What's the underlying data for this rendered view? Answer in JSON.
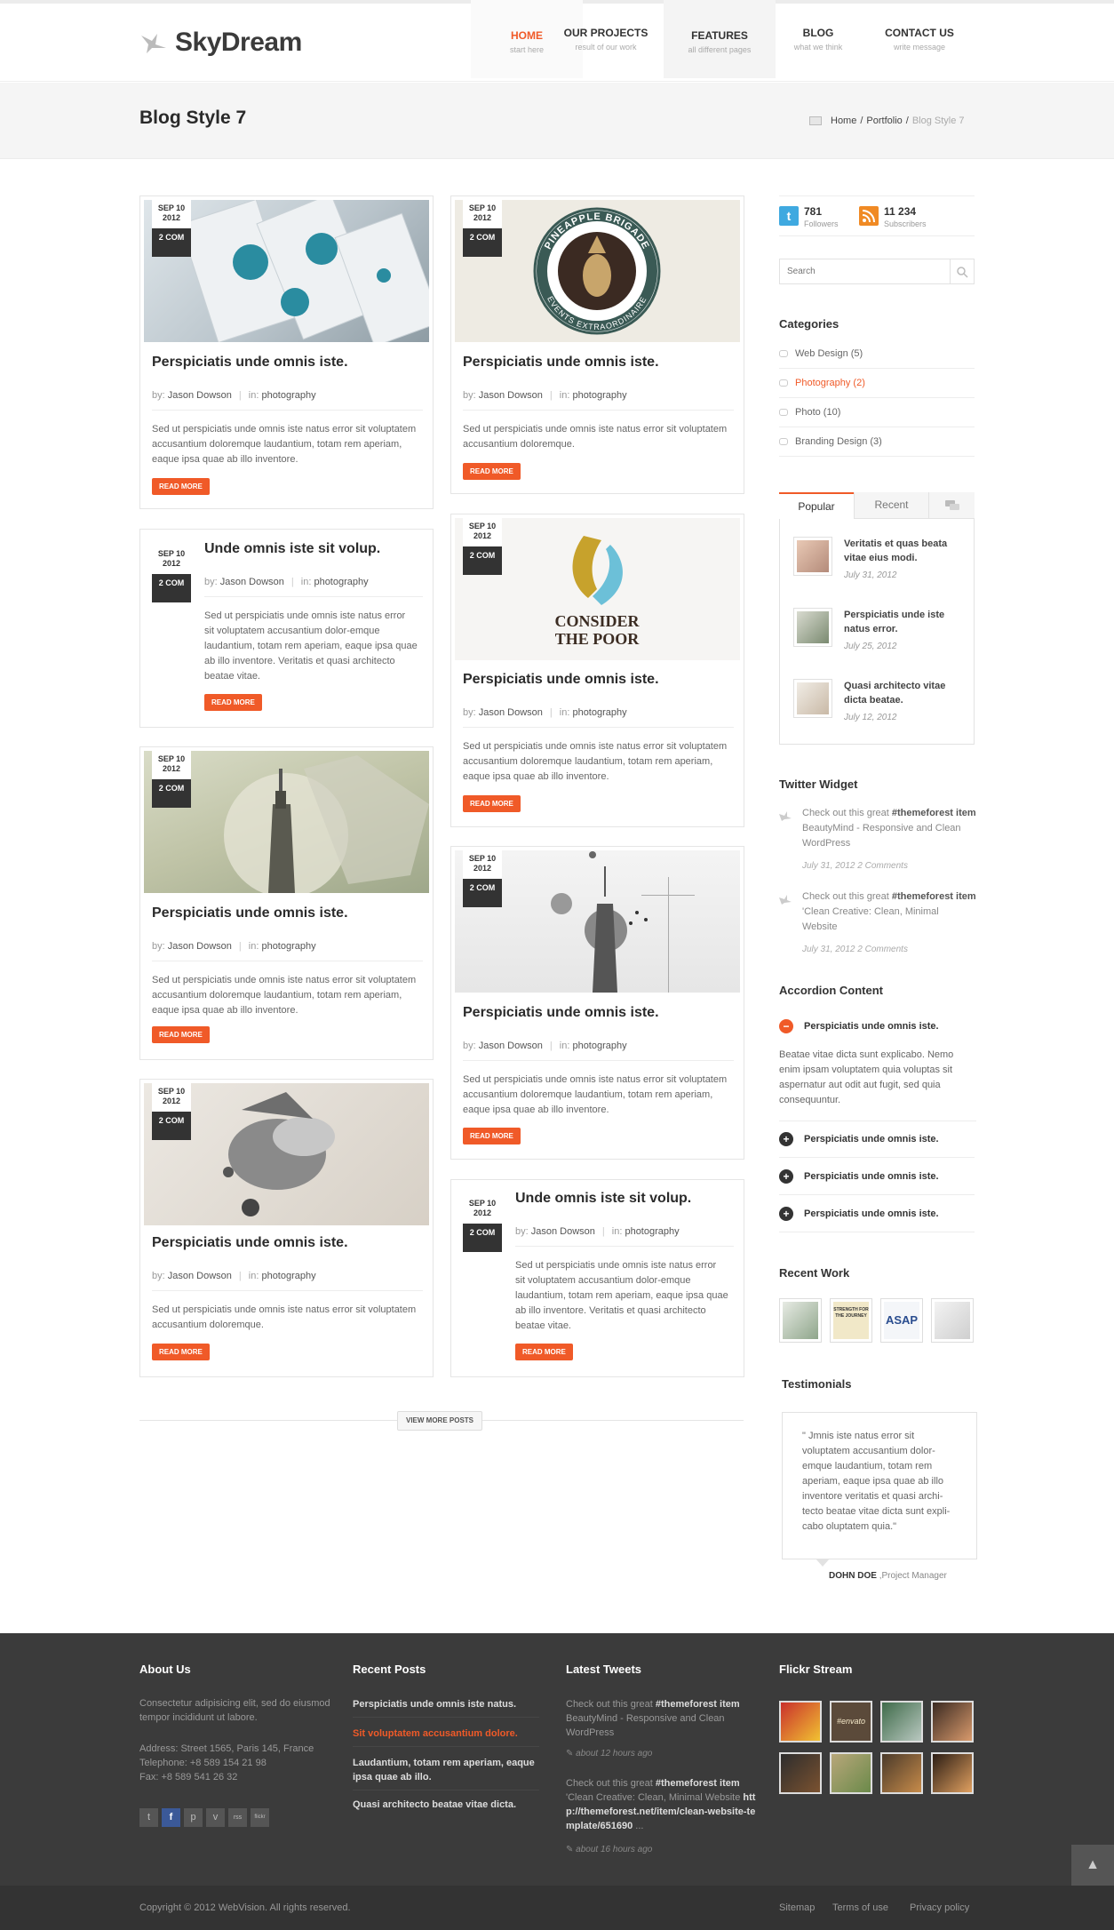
{
  "brand": {
    "name": "SkyDream"
  },
  "nav": [
    {
      "label": "HOME",
      "sub": "start here"
    },
    {
      "label": "OUR PROJECTS",
      "sub": "result of our work"
    },
    {
      "label": "FEATURES",
      "sub": "all different pages"
    },
    {
      "label": "BLOG",
      "sub": "what we think"
    },
    {
      "label": "CONTACT US",
      "sub": "write message"
    }
  ],
  "page": {
    "title": "Blog Style 7",
    "breadcrumb": [
      "Home",
      "/",
      "Portfolio",
      "/",
      "Blog Style 7"
    ]
  },
  "posts": [
    {
      "date": "SEP 10 2012",
      "comments": "2 COM",
      "title": "Perspiciatis unde omnis iste.",
      "by": "by:",
      "author": "Jason Dowson",
      "in": "in:",
      "category": "photography",
      "excerpt": "Sed ut perspiciatis unde omnis iste natus error sit voluptatem accusantium doloremque laudantium, totam rem aperiam, eaque ipsa quae ab illo inventore.",
      "read_more": "READ MORE"
    },
    {
      "date": "SEP 10 2012",
      "comments": "2 COM",
      "title": "Undе omnis iste sit volup.",
      "by": "by:",
      "author": "Jason Dowson",
      "in": "in:",
      "category": "photography",
      "excerpt": "Sed ut perspiciatis unde omnis iste natus error sit voluptatem accusantium dolor-emque laudantium, totam rem aperiam, eaque ipsa quae ab illo inventore. Veritatis et quasi architecto beatae vitae.",
      "read_more": "READ MORE"
    },
    {
      "date": "SEP 10 2012",
      "comments": "2 COM",
      "title": "Perspiciatis unde omnis iste.",
      "by": "by:",
      "author": "Jason Dowson",
      "in": "in:",
      "category": "photography",
      "excerpt": "Sed ut perspiciatis unde omnis iste natus error sit voluptatem accusantium doloremque laudantium, totam rem aperiam, eaque ipsa quae ab illo inventore.",
      "read_more": "READ MORE"
    },
    {
      "date": "SEP 10 2012",
      "comments": "2 COM",
      "title": "Perspiciatis unde omnis iste.",
      "by": "by:",
      "author": "Jason Dowson",
      "in": "in:",
      "category": "photography",
      "excerpt": "Sed ut perspiciatis unde omnis iste natus error sit voluptatem accusantium doloremque.",
      "read_more": "READ MORE"
    },
    {
      "date": "SEP 10 2012",
      "comments": "2 COM",
      "title": "Perspiciatis unde omnis iste.",
      "by": "by:",
      "author": "Jason Dowson",
      "in": "in:",
      "category": "photography",
      "excerpt": "Sed ut perspiciatis unde omnis iste natus error sit voluptatem accusantium doloremque.",
      "read_more": "READ MORE",
      "logo_top": "PINEAPPLE BRIGADE",
      "logo_bottom": "EVENTS EXTRAORDINAIRE"
    },
    {
      "date": "SEP 10 2012",
      "comments": "2 COM",
      "title": "Perspiciatis unde omnis iste.",
      "by": "by:",
      "author": "Jason Dowson",
      "in": "in:",
      "category": "photography",
      "excerpt": "Sed ut perspiciatis unde omnis iste natus error sit voluptatem accusantium doloremque laudantium, totam rem aperiam, eaque ipsa quae ab illo inventore.",
      "read_more": "READ MORE",
      "logo_text1": "CONSIDER",
      "logo_text2": "THE POOR"
    },
    {
      "date": "SEP 10 2012",
      "comments": "2 COM",
      "title": "Perspiciatis unde omnis iste.",
      "by": "by:",
      "author": "Jason Dowson",
      "in": "in:",
      "category": "photography",
      "excerpt": "Sed ut perspiciatis unde omnis iste natus error sit voluptatem accusantium doloremque laudantium, totam rem aperiam, eaque ipsa quae ab illo inventore.",
      "read_more": "READ MORE"
    },
    {
      "date": "SEP 10 2012",
      "comments": "2 COM",
      "title": "Unde omnis iste sit volup.",
      "by": "by:",
      "author": "Jason Dowson",
      "in": "in:",
      "category": "photography",
      "excerpt": "Sed ut perspiciatis unde omnis iste natus error sit voluptatem accusantium dolor-emque laudantium, totam rem aperiam, eaque ipsa quae ab illo inventore. Veritatis et quasi architecto beatae vitae.",
      "read_more": "READ MORE"
    }
  ],
  "view_more": "VIEW MORE POSTS",
  "sidebar": {
    "twitter": {
      "count": "781",
      "label": "Followers"
    },
    "rss": {
      "count": "11 234",
      "label": "Subscribers"
    },
    "search_placeholder": "Search",
    "categories_title": "Categories",
    "categories": [
      "Web Design (5)",
      "Photography (2)",
      "Photo (10)",
      "Branding Design (3)"
    ],
    "tabs": [
      "Popular",
      "Recent"
    ],
    "popular": [
      {
        "title": "Veritatis et quas beata vitae eius modi.",
        "date": "July 31, 2012"
      },
      {
        "title": "Perspiciatis unde iste natus error.",
        "date": "July 25, 2012"
      },
      {
        "title": "Quasi architecto vitae dicta beatae.",
        "date": "July 12, 2012"
      }
    ],
    "twitter_title": "Twitter Widget",
    "tweets": [
      {
        "pre": "Check out this great ",
        "tag": "#themeforest item",
        "post": " BeautyMind - Responsive and Clean WordPress",
        "when": "July 31, 2012 2 Comments"
      },
      {
        "pre": "Check out this great ",
        "tag": "#themeforest item",
        "post": " 'Clean Creative: Clean, Minimal Website",
        "when": "July 31, 2012 2 Comments"
      }
    ],
    "accordion_title": "Accordion Content",
    "accordion": [
      {
        "title": "Perspiciatis unde omnis iste.",
        "body": "Beatae vitae dicta sunt explicabo. Nemo enim ipsam voluptatem quia voluptas sit aspernatur aut odit aut fugit, sed quia consequuntur."
      },
      {
        "title": "Perspiciatis unde omnis iste."
      },
      {
        "title": "Perspiciatis unde omnis iste."
      },
      {
        "title": "Perspiciatis unde omnis iste."
      }
    ],
    "recent_work_title": "Recent Work",
    "recent_work": [
      "",
      "STRENGTH FOR THE JOURNEY",
      "ASAP",
      ""
    ],
    "testimonials_title": "Testimonials",
    "testimonial": {
      "quote": "\" Jmnis iste natus error sit voluptatem accusantium dolor-emque laudantium, totam rem aperiam, eaque ipsa quae ab illo inventore veritatis et quasi archi-tecto beatae vitae dicta sunt expli-cabo oluptatem quia.\"",
      "name": "DOHN DOE",
      "role": ",Project Manager"
    }
  },
  "footer": {
    "about_title": "About Us",
    "about_text": "Consectetur adipisicing elit, sed do eiusmod tempor incididunt ut labore.",
    "address": "Address: Street 1565, Paris 145, France",
    "phone": "Telephone: +8 589 154 21 98",
    "fax": "Fax: +8 589 541 26 32",
    "social": [
      "t",
      "f",
      "p",
      "v",
      "rss",
      "flickr"
    ],
    "recent_title": "Recent Posts",
    "recent_posts": [
      "Perspiciatis unde omnis iste natus.",
      "Sit voluptatem accusantium dolore.",
      "Laudantium, totam rem aperiam, eaque ipsa quae ab illo.",
      "Quasi architecto beatae vitae dicta."
    ],
    "tweets_title": "Latest Tweets",
    "tweets": [
      {
        "pre": "Check out this great ",
        "tag": "#themeforest item",
        "post": " BeautyMind - Responsive and Clean WordPress",
        "when": "about 12 hours ago"
      },
      {
        "pre": "Check out this great ",
        "tag": "#themeforest item",
        "post": " 'Clean Creative: Clean, Minimal Website ",
        "link": "http://themeforest.net/item/clean-website-template/651690",
        "tail": " ...",
        "when": "about 16 hours ago"
      }
    ],
    "flickr_title": "Flickr Stream",
    "flickr_badge": "#envato",
    "copyright": "Copyright © 2012 WebVision. All rights reserved.",
    "links": [
      "Sitemap",
      "Terms of use",
      "Privacy policy"
    ]
  },
  "colors": {
    "accent": "#f05a28",
    "dark": "#333333",
    "footer": "#3b3b3b"
  }
}
